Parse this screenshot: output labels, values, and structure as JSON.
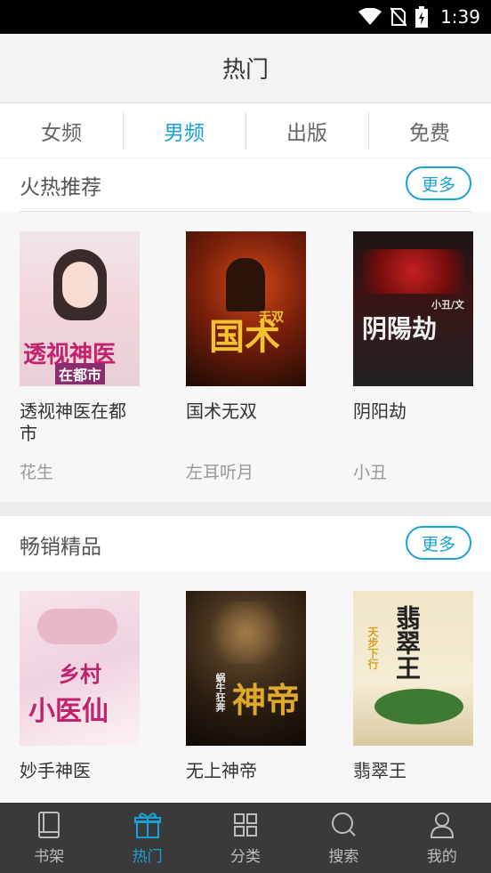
{
  "status": {
    "time": "1:39"
  },
  "header": {
    "title": "热门"
  },
  "tabs": [
    {
      "label": "女频",
      "active": false
    },
    {
      "label": "男频",
      "active": true
    },
    {
      "label": "出版",
      "active": false
    },
    {
      "label": "免费",
      "active": false
    }
  ],
  "sections": [
    {
      "title": "火热推荐",
      "more": "更多",
      "books": [
        {
          "title": "透视神医在都市",
          "author": "花生",
          "cover_text": "透视神医",
          "cover_sub": "在都市"
        },
        {
          "title": "国术无双",
          "author": "左耳听月",
          "cover_text": "国术",
          "cover_sub": "无双"
        },
        {
          "title": "阴阳劫",
          "author": "小丑",
          "cover_text": "阴陽劫",
          "cover_sub": "小丑/文"
        }
      ]
    },
    {
      "title": "畅销精品",
      "more": "更多",
      "books": [
        {
          "title": "妙手神医",
          "cover_text": "乡村",
          "cover_sub": "小医仙"
        },
        {
          "title": "无上神帝",
          "cover_text": "神帝",
          "cover_sub": "蜗牛狂奔"
        },
        {
          "title": "翡翠王",
          "cover_text": "翡翠王",
          "cover_sub": "天步下行"
        }
      ]
    }
  ],
  "nav": [
    {
      "label": "书架",
      "icon": "bookshelf-icon",
      "active": false
    },
    {
      "label": "热门",
      "icon": "gift-icon",
      "active": true
    },
    {
      "label": "分类",
      "icon": "grid-icon",
      "active": false
    },
    {
      "label": "搜索",
      "icon": "search-icon",
      "active": false
    },
    {
      "label": "我的",
      "icon": "user-icon",
      "active": false
    }
  ],
  "colors": {
    "accent": "#1aa0d8",
    "nav_bg": "#3a3a3a",
    "title_bg": "#f3f3f3"
  }
}
